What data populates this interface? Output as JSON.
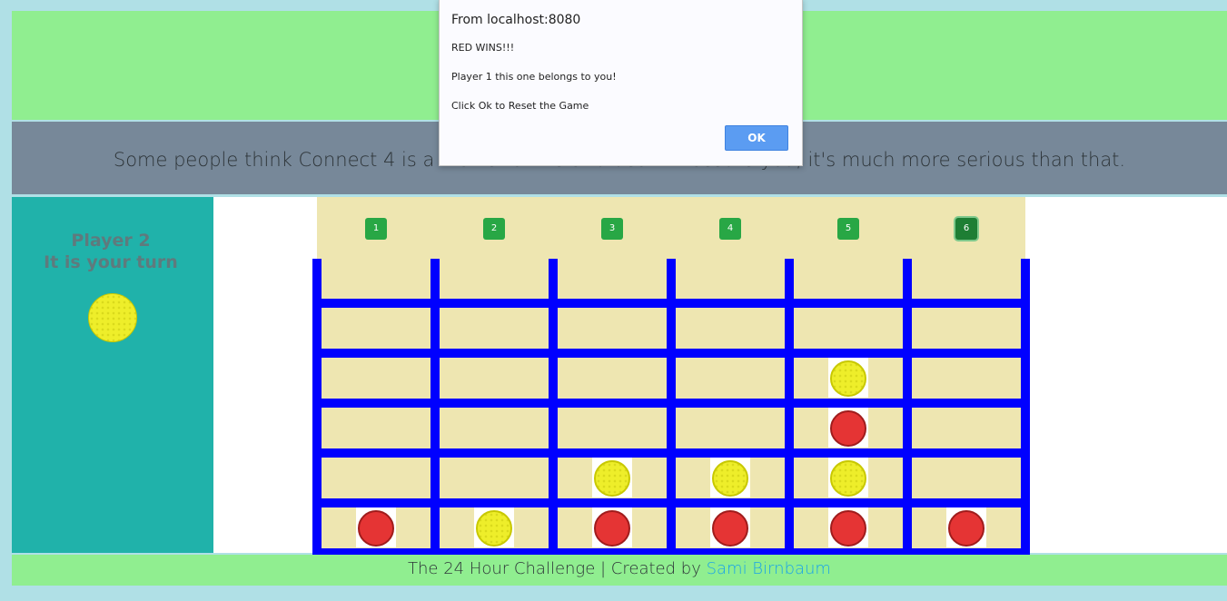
{
  "page": {
    "tagline": "Some people think Connect 4 is a matter of life and death. I assure you, it's much more serious than that."
  },
  "sidebar": {
    "player_name": "Player 2",
    "status": "It is your turn",
    "current_disc_color": "yellow"
  },
  "board": {
    "columns": [
      "1",
      "2",
      "3",
      "4",
      "5",
      "6"
    ],
    "active_column": 6,
    "rows": 6,
    "cells": [
      [
        "",
        "",
        "",
        "",
        "",
        ""
      ],
      [
        "",
        "",
        "",
        "",
        "",
        ""
      ],
      [
        "",
        "",
        "",
        "",
        "yellow",
        ""
      ],
      [
        "",
        "",
        "",
        "",
        "red",
        ""
      ],
      [
        "",
        "",
        "yellow",
        "yellow",
        "yellow",
        ""
      ],
      [
        "red",
        "yellow",
        "red",
        "red",
        "red",
        "red"
      ]
    ]
  },
  "footer": {
    "text": "The 24 Hour Challenge | Created by",
    "author": "Sami Birnbaum"
  },
  "dialog": {
    "origin": "From localhost:8080",
    "line1": "RED WINS!!!",
    "line2": "Player 1 this one belongs to you!",
    "line3": "Click Ok to Reset the Game",
    "ok_label": "OK"
  },
  "colors": {
    "board_frame": "#0000ff",
    "cell": "#eee6b1",
    "red": "#e53434",
    "yellow": "#eeee2a",
    "header": "#90ee90",
    "tagline_bar": "#778899",
    "sidebar": "#20b2aa",
    "button": "#28a745",
    "ok_button": "#5b9cf2"
  }
}
